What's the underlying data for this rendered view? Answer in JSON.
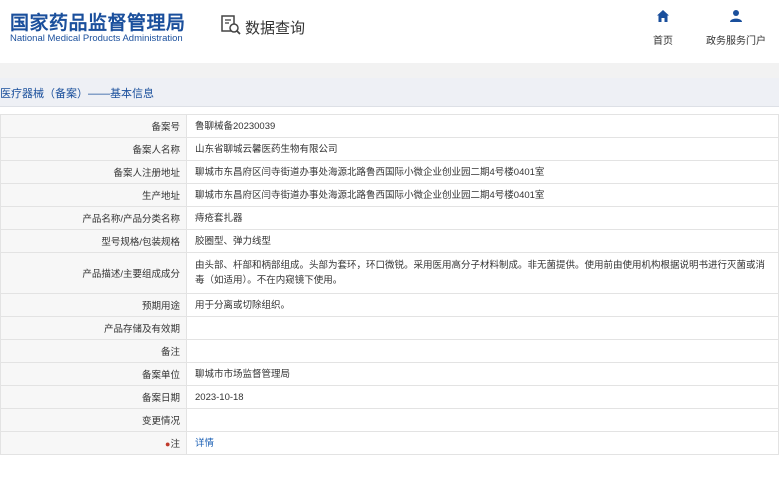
{
  "header": {
    "logo_cn": "国家药品监督管理局",
    "logo_en": "National Medical Products Administration",
    "search_title": "数据查询",
    "nav": [
      {
        "label": "首页",
        "icon": "home-icon"
      },
      {
        "label": "政务服务门户",
        "icon": "user-icon"
      }
    ]
  },
  "section": {
    "title": "医疗器械（备案）——基本信息"
  },
  "rows": [
    {
      "label": "备案号",
      "value": "鲁聊械备20230039"
    },
    {
      "label": "备案人名称",
      "value": "山东省聊城云馨医药生物有限公司"
    },
    {
      "label": "备案人注册地址",
      "value": "聊城市东昌府区闫寺街道办事处海源北路鲁西国际小微企业创业园二期4号楼0401室"
    },
    {
      "label": "生产地址",
      "value": "聊城市东昌府区闫寺街道办事处海源北路鲁西国际小微企业创业园二期4号楼0401室"
    },
    {
      "label": "产品名称/产品分类名称",
      "value": "痔疮套扎器"
    },
    {
      "label": "型号规格/包装规格",
      "value": "胶圈型、弹力线型"
    },
    {
      "label": "产品描述/主要组成成分",
      "value": "由头部、杆部和柄部组成。头部为套环，环口微锐。采用医用高分子材料制成。非无菌提供。使用前由使用机构根据说明书进行灭菌或消毒（如适用）。不在内窥镜下使用。"
    },
    {
      "label": "预期用途",
      "value": "用于分离或切除组织。"
    },
    {
      "label": "产品存储及有效期",
      "value": ""
    },
    {
      "label": "备注",
      "value": ""
    },
    {
      "label": "备案单位",
      "value": "聊城市市场监督管理局"
    },
    {
      "label": "备案日期",
      "value": "2023-10-18"
    },
    {
      "label": "变更情况",
      "value": ""
    }
  ],
  "note_row": {
    "label": "注",
    "link": "详情"
  },
  "colors": {
    "brand_blue": "#1a4f9c",
    "link_blue": "#1a5fb4",
    "label_bg": "#f7f7f7",
    "section_bg": "#eef0f5"
  }
}
